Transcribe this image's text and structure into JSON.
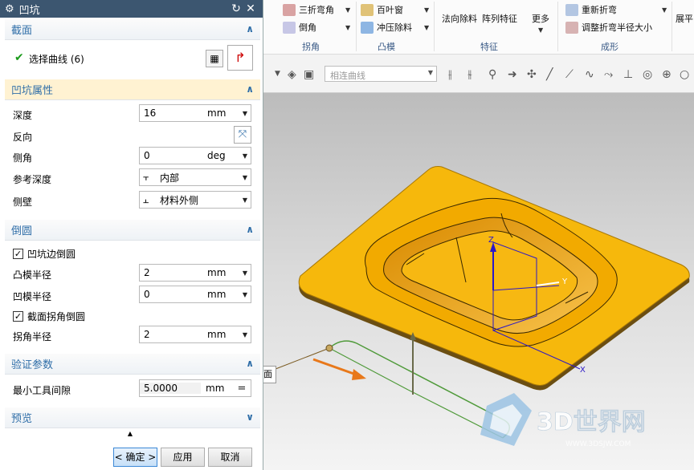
{
  "dialog": {
    "title": "凹坑",
    "sections": {
      "section": {
        "title": "截面",
        "select_curve": "选择曲线 (6)"
      },
      "properties": {
        "title": "凹坑属性",
        "depth_label": "深度",
        "depth_value": "16",
        "depth_unit": "mm",
        "reverse_label": "反向",
        "angle_label": "侧角",
        "angle_value": "0",
        "angle_unit": "deg",
        "ref_depth_label": "参考深度",
        "ref_depth_value": "内部",
        "side_wall_label": "侧壁",
        "side_wall_value": "材料外侧"
      },
      "fillet": {
        "title": "倒圆",
        "fillet_edges_label": "凹坑边倒圆",
        "punch_radius_label": "凸模半径",
        "punch_radius_value": "2",
        "punch_radius_unit": "mm",
        "die_radius_label": "凹模半径",
        "die_radius_value": "0",
        "die_radius_unit": "mm",
        "corner_fillet_label": "截面拐角倒圆",
        "corner_radius_label": "拐角半径",
        "corner_radius_value": "2",
        "corner_radius_unit": "mm"
      },
      "verify": {
        "title": "验证参数",
        "min_gap_label": "最小工具间隙",
        "min_gap_value": "5.0000",
        "min_gap_unit": "mm"
      },
      "preview": {
        "title": "预览"
      }
    },
    "buttons": {
      "ok": "< 确定 >",
      "apply": "应用",
      "cancel": "取消"
    }
  },
  "ribbon": {
    "tri_bend": "三折弯角",
    "chamfer": "倒角",
    "corner_group": "拐角",
    "louver": "百叶窗",
    "punch_cut": "冲压除料",
    "emboss_group": "凸模",
    "normal_cut": "法向除料",
    "pattern_feature": "阵列特征",
    "more": "更多",
    "feature_group": "特征",
    "rebend": "重新折弯",
    "adjust_bend_radius": "调整折弯半径大小",
    "forming_group": "成形",
    "flatten": "展平"
  },
  "toolbar": {
    "filter_placeholder": "相连曲线"
  },
  "viewport": {
    "partial_label": "面",
    "axis_z": "Z",
    "axis_y": "Y",
    "axis_x": "X",
    "watermark": "3D世界网",
    "watermark_url": "WWW.3DSJW.COM"
  },
  "colors": {
    "accent": "#2f6ea8",
    "part": "#f6b80c",
    "title_bar": "#3c5670"
  }
}
